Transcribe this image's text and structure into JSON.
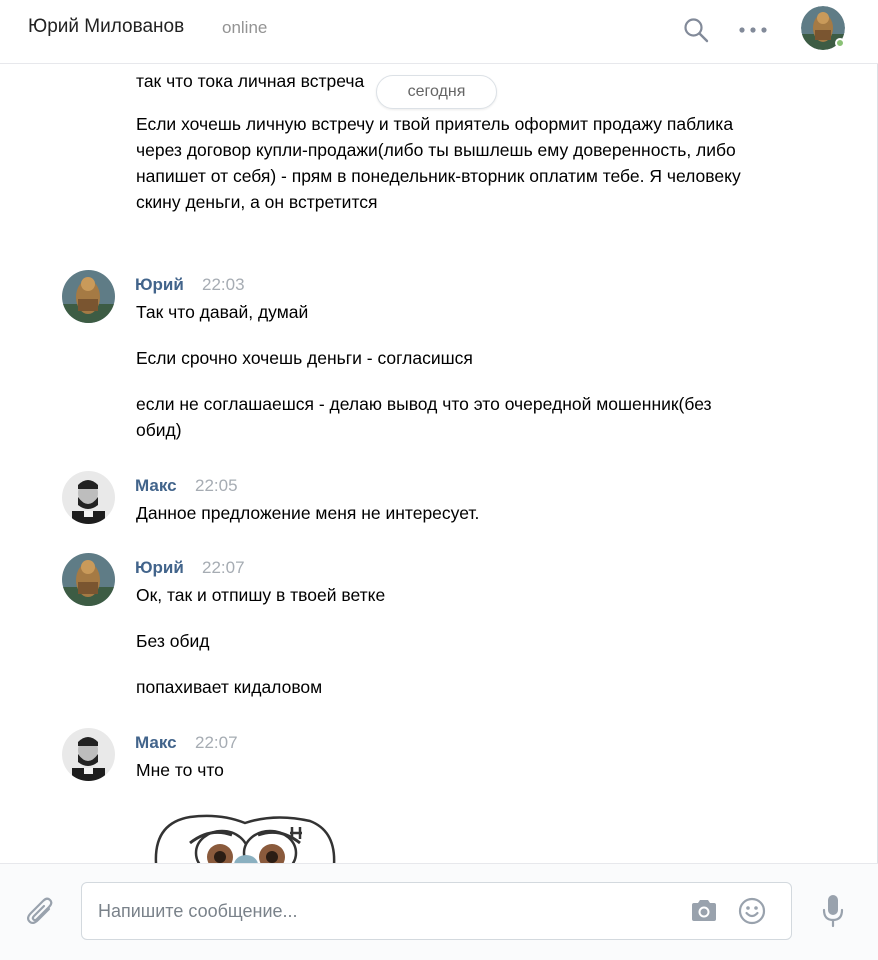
{
  "header": {
    "name": "Юрий Милованов",
    "status": "online"
  },
  "date_separator": "сегодня",
  "messages": [
    {
      "lines": [
        "так что тока личная встреча",
        "Если хочешь личную встречу и твой приятель оформит продажу паблика через договор купли-продажи(либо ты вышлешь ему доверенность, либо напишет от себя) - прям в понедельник-вторник оплатим тебе. Я человеку скину деньги, а он встретится"
      ]
    },
    {
      "author": "Юрий",
      "time": "22:03",
      "lines": [
        "Так что давай, думай",
        "Если срочно хочешь деньги - согласишся",
        "если не соглашаешся - делаю вывод что это очередной мошенник(без обид)"
      ]
    },
    {
      "author": "Макс",
      "time": "22:05",
      "lines": [
        "Данное предложение меня не интересует."
      ]
    },
    {
      "author": "Юрий",
      "time": "22:07",
      "lines": [
        "Ок, так и отпишу в твоей ветке",
        "Без обид",
        "попахивает кидаловом"
      ]
    },
    {
      "author": "Макс",
      "time": "22:07",
      "lines": [
        "Мне то что"
      ]
    }
  ],
  "composer": {
    "placeholder": "Напишите сообщение..."
  },
  "colors": {
    "author": "#42648b",
    "time": "#a6acb3",
    "online": "#8ac176",
    "status": "#939393"
  },
  "icons": [
    "search-icon",
    "more-icon",
    "paperclip-icon",
    "camera-icon",
    "smile-icon",
    "microphone-icon",
    "sticker-image"
  ]
}
